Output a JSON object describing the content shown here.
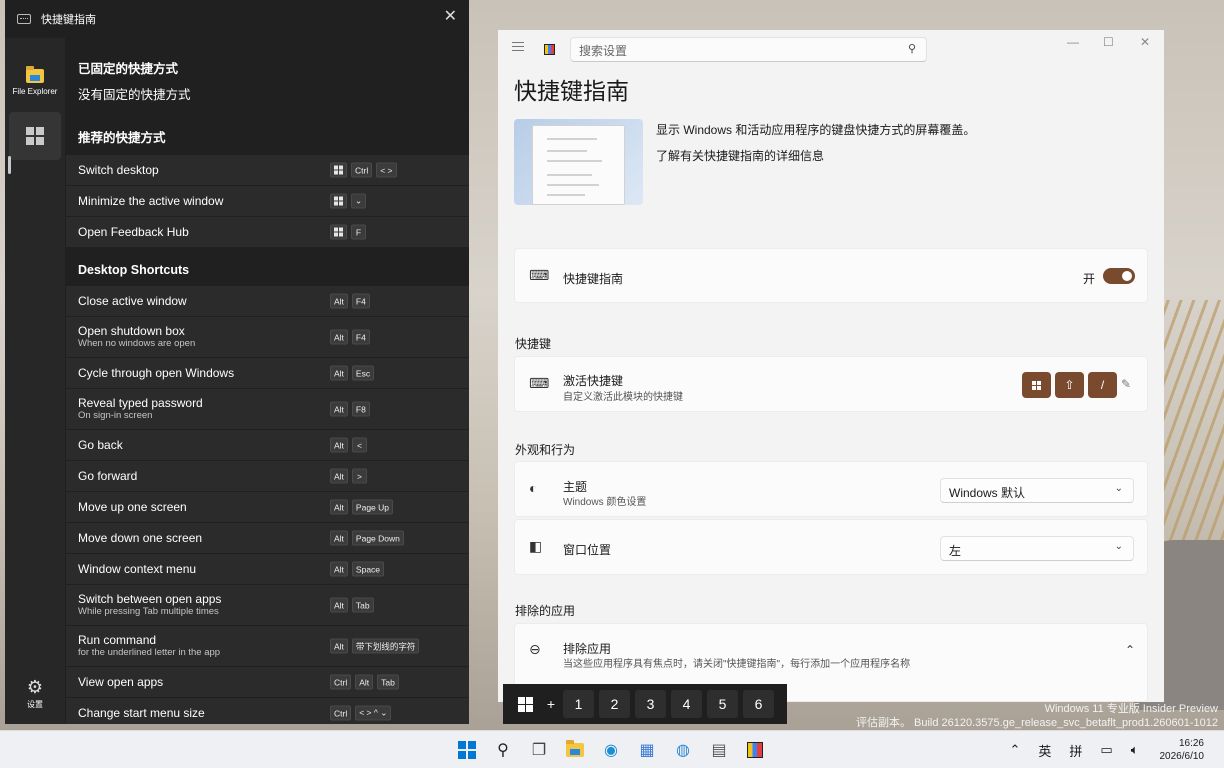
{
  "overlay": {
    "title": "快捷键指南",
    "rail": {
      "file_explorer_label": "File Explorer",
      "settings_label": "设置"
    },
    "pinned": {
      "heading": "已固定的快捷方式",
      "empty_note": "没有固定的快捷方式"
    },
    "recommended": {
      "heading": "推荐的快捷方式",
      "items": [
        {
          "label": "Switch desktop",
          "keys": [
            "win",
            "Ctrl",
            "< >"
          ]
        },
        {
          "label": "Minimize the active window",
          "keys": [
            "win",
            "⌄"
          ]
        },
        {
          "label": "Open Feedback Hub",
          "keys": [
            "win",
            "F"
          ]
        }
      ]
    },
    "desktop": {
      "heading": "Desktop Shortcuts",
      "items": [
        {
          "label": "Close active window",
          "sub": "",
          "keys": [
            "Alt",
            "F4"
          ]
        },
        {
          "label": "Open shutdown box",
          "sub": "When no windows are open",
          "keys": [
            "Alt",
            "F4"
          ]
        },
        {
          "label": "Cycle through open Windows",
          "sub": "",
          "keys": [
            "Alt",
            "Esc"
          ]
        },
        {
          "label": "Reveal typed password",
          "sub": "On sign-in screen",
          "keys": [
            "Alt",
            "F8"
          ]
        },
        {
          "label": "Go back",
          "sub": "",
          "keys": [
            "Alt",
            "<"
          ]
        },
        {
          "label": "Go forward",
          "sub": "",
          "keys": [
            "Alt",
            ">"
          ]
        },
        {
          "label": "Move up one screen",
          "sub": "",
          "keys": [
            "Alt",
            "Page Up"
          ]
        },
        {
          "label": "Move down one screen",
          "sub": "",
          "keys": [
            "Alt",
            "Page Down"
          ]
        },
        {
          "label": "Window context menu",
          "sub": "",
          "keys": [
            "Alt",
            "Space"
          ]
        },
        {
          "label": "Switch between open apps",
          "sub": "While pressing Tab multiple times",
          "keys": [
            "Alt",
            "Tab"
          ]
        },
        {
          "label": "Run command",
          "sub": "for the underlined letter in the app",
          "keys": [
            "Alt",
            "带下划线的字符"
          ]
        },
        {
          "label": "View open apps",
          "sub": "",
          "keys": [
            "Ctrl",
            "Alt",
            "Tab"
          ]
        },
        {
          "label": "Change start menu size",
          "sub": "",
          "keys": [
            "Ctrl",
            "< > ^ ⌄"
          ]
        }
      ]
    }
  },
  "settings": {
    "search_placeholder": "搜索设置",
    "page_title": "快捷键指南",
    "description": "显示 Windows 和活动应用程序的键盘快捷方式的屏幕覆盖。",
    "learn_more": "了解有关快捷键指南的详细信息",
    "enable": {
      "label": "快捷键指南",
      "state": "开"
    },
    "shortcut_group": "快捷键",
    "activation": {
      "title": "激活快捷键",
      "sub": "自定义激活此模块的快捷键",
      "keys": [
        "win",
        "⇧",
        "/"
      ]
    },
    "appearance_group": "外观和行为",
    "theme": {
      "title": "主题",
      "sub": "Windows 颜色设置",
      "value": "Windows 默认"
    },
    "position": {
      "title": "窗口位置",
      "value": "左"
    },
    "excluded_group": "排除的应用",
    "exclude": {
      "title": "排除应用",
      "sub": "当这些应用程序具有焦点时，请关闭\"快捷键指南\"，每行添加一个应用程序名称"
    }
  },
  "numstrip": {
    "plus": "+",
    "numbers": [
      "1",
      "2",
      "3",
      "4",
      "5",
      "6"
    ]
  },
  "watermark": {
    "line1": "Windows 11 专业版 Insider Preview",
    "line2": "评估副本。 Build 26120.3575.ge_release_svc_betaflt_prod1.260601-1012"
  },
  "taskbar": {
    "tray_ime1": "英",
    "tray_ime2": "拼",
    "time": "16:26",
    "date": "2026/6/10"
  },
  "colors": {
    "accent": "#7a4a2e",
    "overlay_bg": "#202020",
    "row_bg": "#2b2b2b"
  }
}
